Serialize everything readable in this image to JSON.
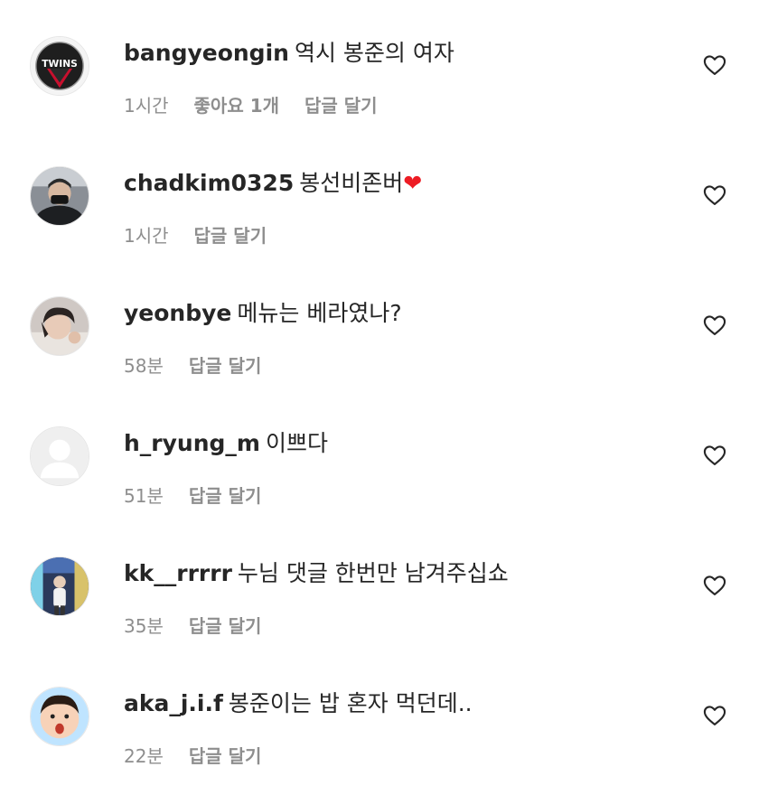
{
  "comments": [
    {
      "username": "bangyeongin",
      "text": "역시 봉준의 여자",
      "emoji": "",
      "time": "1시간",
      "likes": "좋아요 1개",
      "reply": "답글 달기",
      "avatar": "lg-twins-logo"
    },
    {
      "username": "chadkim0325",
      "text": "봉선비존버",
      "emoji": "❤",
      "time": "1시간",
      "likes": "",
      "reply": "답글 달기",
      "avatar": "photo-man-mask"
    },
    {
      "username": "yeonbye",
      "text": "메뉴는 베라였나?",
      "emoji": "",
      "time": "58분",
      "likes": "",
      "reply": "답글 달기",
      "avatar": "photo-person"
    },
    {
      "username": "h_ryung_m",
      "text": "이쁘다",
      "emoji": "",
      "time": "51분",
      "likes": "",
      "reply": "답글 달기",
      "avatar": "default-avatar"
    },
    {
      "username": "kk__rrrrr",
      "text": "누님 댓글 한번만 남겨주십쇼",
      "emoji": "",
      "time": "35분",
      "likes": "",
      "reply": "답글 달기",
      "avatar": "photo-arcade"
    },
    {
      "username": "aka_j.i.f",
      "text": "봉준이는 밥 혼자 먹던데..",
      "emoji": "",
      "time": "22분",
      "likes": "",
      "reply": "답글 달기",
      "avatar": "photo-cartoon-face"
    }
  ],
  "colors": {
    "text": "#262626",
    "meta": "#8e8e8e",
    "heart_emoji": "#ed1c24"
  },
  "icons": {
    "like": "heart-outline-icon"
  }
}
